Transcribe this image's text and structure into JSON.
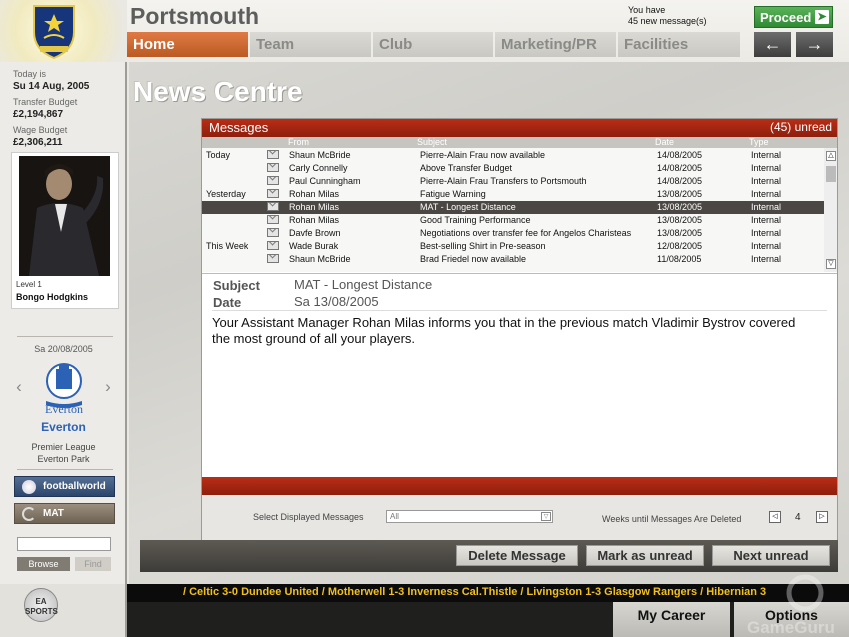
{
  "header": {
    "club_title": "Portsmouth",
    "message_notice_line1": "You have",
    "message_notice_line2": "45 new message(s)",
    "proceed_label": "Proceed",
    "tabs": [
      {
        "label": "Home"
      },
      {
        "label": "Team"
      },
      {
        "label": "Club"
      },
      {
        "label": "Marketing/PR"
      },
      {
        "label": "Facilities"
      }
    ],
    "back_arrow": "🡐",
    "forward_arrow": "🡒"
  },
  "sidebar": {
    "today_label": "Today is",
    "today_value": "Su 14 Aug, 2005",
    "transfer_label": "Transfer Budget",
    "transfer_value": "£2,194,867",
    "wage_label": "Wage Budget",
    "wage_value": "£2,306,211",
    "level": "Level 1",
    "manager_name": "Bongo Hodgkins",
    "fixture_date": "Sa 20/08/2005",
    "opponent_name": "Everton",
    "league": "Premier League",
    "stadium": "Everton Park",
    "footballworld_label": "footballworld",
    "mat_label": "MAT",
    "browse_label": "Browse",
    "find_label": "Find"
  },
  "main": {
    "page_title": "News Centre",
    "messages_header": "Messages",
    "unread_count": "(45) unread",
    "columns": {
      "from": "From",
      "subject": "Subject",
      "date": "Date",
      "type": "Type"
    },
    "messages": [
      {
        "group": "Today",
        "from": "Shaun McBride",
        "subject": "Pierre-Alain Frau now available",
        "date": "14/08/2005",
        "type": "Internal"
      },
      {
        "group": "",
        "from": "Carly Connelly",
        "subject": "Above Transfer Budget",
        "date": "14/08/2005",
        "type": "Internal"
      },
      {
        "group": "",
        "from": "Paul Cunningham",
        "subject": "Pierre-Alain Frau Transfers to Portsmouth",
        "date": "14/08/2005",
        "type": "Internal"
      },
      {
        "group": "Yesterday",
        "from": "Rohan Milas",
        "subject": "Fatigue Warning",
        "date": "13/08/2005",
        "type": "Internal"
      },
      {
        "group": "",
        "from": "Rohan Milas",
        "subject": "MAT - Longest Distance",
        "date": "13/08/2005",
        "type": "Internal"
      },
      {
        "group": "",
        "from": "Rohan Milas",
        "subject": "Good Training Performance",
        "date": "13/08/2005",
        "type": "Internal"
      },
      {
        "group": "",
        "from": "Davfe Brown",
        "subject": "Negotiations over transfer fee for Angelos Charisteas",
        "date": "13/08/2005",
        "type": "Internal"
      },
      {
        "group": "This Week",
        "from": "Wade Burak",
        "subject": "Best-selling Shirt in Pre-season",
        "date": "12/08/2005",
        "type": "Internal"
      },
      {
        "group": "",
        "from": "Shaun McBride",
        "subject": "Brad Friedel now available",
        "date": "11/08/2005",
        "type": "Internal"
      }
    ],
    "detail": {
      "subject_label": "Subject",
      "subject_value": "MAT - Longest Distance",
      "date_label": "Date",
      "date_value": "Sa 13/08/2005",
      "body": "Your Assistant Manager Rohan Milas informs you that in the previous match Vladimir Bystrov covered the most ground of all your players."
    },
    "filter": {
      "select_label": "Select Displayed Messages",
      "select_value": "All",
      "weeks_label": "Weeks until Messages Are Deleted",
      "weeks_value": "4"
    },
    "actions": {
      "delete": "Delete Message",
      "mark_unread": "Mark as unread",
      "next_unread": "Next unread"
    }
  },
  "ticker": "/   Celtic 3-0 Dundee United   /   Motherwell 1-3 Inverness Cal.Thistle   /   Livingston 1-3 Glasgow Rangers   /   Hibernian 3",
  "footer": {
    "ea_logo": "EA SPORTS",
    "my_career": "My Career",
    "options": "Options",
    "watermark": "GameGuru"
  },
  "colors": {
    "accent": "#c6581f",
    "red_bar": "#a6260f",
    "proceed_green": "#3a9a3c",
    "everton_blue": "#2c62b5"
  }
}
